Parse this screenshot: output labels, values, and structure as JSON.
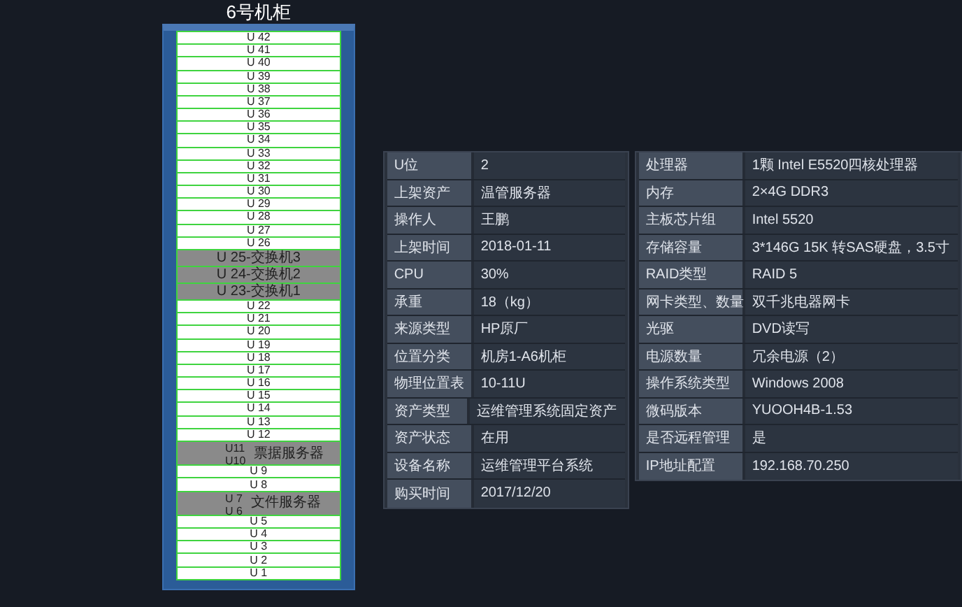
{
  "rack": {
    "title": "6号机柜",
    "slots": [
      {
        "kind": "free",
        "label": "U 42"
      },
      {
        "kind": "free",
        "label": "U 41"
      },
      {
        "kind": "free",
        "label": "U 40"
      },
      {
        "kind": "free",
        "label": "U 39"
      },
      {
        "kind": "free",
        "label": "U 38"
      },
      {
        "kind": "free",
        "label": "U 37"
      },
      {
        "kind": "free",
        "label": "U 36"
      },
      {
        "kind": "free",
        "label": "U 35"
      },
      {
        "kind": "free",
        "label": "U 34"
      },
      {
        "kind": "free",
        "label": "U 33"
      },
      {
        "kind": "free",
        "label": "U 32"
      },
      {
        "kind": "free",
        "label": "U 31"
      },
      {
        "kind": "free",
        "label": "U 30"
      },
      {
        "kind": "free",
        "label": "U 29"
      },
      {
        "kind": "free",
        "label": "U 28"
      },
      {
        "kind": "free",
        "label": "U 27"
      },
      {
        "kind": "free",
        "label": "U 26"
      },
      {
        "kind": "single",
        "label": "U 25-交换机3"
      },
      {
        "kind": "single",
        "label": "U 24-交换机2"
      },
      {
        "kind": "single",
        "label": "U 23-交换机1"
      },
      {
        "kind": "free",
        "label": "U 22"
      },
      {
        "kind": "free",
        "label": "U 21"
      },
      {
        "kind": "free",
        "label": "U 20"
      },
      {
        "kind": "free",
        "label": "U 19"
      },
      {
        "kind": "free",
        "label": "U 18"
      },
      {
        "kind": "free",
        "label": "U 17"
      },
      {
        "kind": "free",
        "label": "U 16"
      },
      {
        "kind": "free",
        "label": "U 15"
      },
      {
        "kind": "free",
        "label": "U 14"
      },
      {
        "kind": "free",
        "label": "U 13"
      },
      {
        "kind": "free",
        "label": "U 12"
      },
      {
        "kind": "multi",
        "units": [
          "U11",
          "U10"
        ],
        "name": "票据服务器"
      },
      {
        "kind": "free",
        "label": "U 9"
      },
      {
        "kind": "free",
        "label": "U 8"
      },
      {
        "kind": "multi",
        "units": [
          "U 7",
          "U 6"
        ],
        "name": "文件服务器"
      },
      {
        "kind": "free",
        "label": "U 5"
      },
      {
        "kind": "free",
        "label": "U 4"
      },
      {
        "kind": "free",
        "label": "U 3"
      },
      {
        "kind": "free",
        "label": "U 2"
      },
      {
        "kind": "free",
        "label": "U 1"
      }
    ]
  },
  "asset_table": {
    "rows": [
      {
        "label": "U位",
        "value": "2"
      },
      {
        "label": "上架资产",
        "value": "温管服务器"
      },
      {
        "label": "操作人",
        "value": "王鹏"
      },
      {
        "label": "上架时间",
        "value": "2018-01-11"
      },
      {
        "label": "CPU",
        "value": "30%"
      },
      {
        "label": "承重",
        "value": "18（kg）"
      },
      {
        "label": "来源类型",
        "value": "HP原厂"
      },
      {
        "label": "位置分类",
        "value": "机房1-A6机柜"
      },
      {
        "label": "物理位置表",
        "value": "10-11U"
      },
      {
        "label": "资产类型",
        "value": "运维管理系统固定资产"
      },
      {
        "label": "资产状态",
        "value": "在用"
      },
      {
        "label": "设备名称",
        "value": "运维管理平台系统"
      },
      {
        "label": "购买时间",
        "value": "2017/12/20"
      }
    ]
  },
  "spec_table": {
    "rows": [
      {
        "label": "处理器",
        "value": "1颗 Intel E5520四核处理器"
      },
      {
        "label": "内存",
        "value": "2×4G DDR3"
      },
      {
        "label": "主板芯片组",
        "value": "Intel 5520"
      },
      {
        "label": "存储容量",
        "value": "3*146G 15K 转SAS硬盘，3.5寸"
      },
      {
        "label": "RAID类型",
        "value": "RAID 5"
      },
      {
        "label": "网卡类型、数量",
        "value": "双千兆电器网卡"
      },
      {
        "label": "光驱",
        "value": "DVD读写"
      },
      {
        "label": "电源数量",
        "value": "冗余电源（2）"
      },
      {
        "label": "操作系统类型",
        "value": "Windows 2008"
      },
      {
        "label": "微码版本",
        "value": "YUOOH4B-1.53"
      },
      {
        "label": "是否远程管理",
        "value": "是"
      },
      {
        "label": "IP地址配置",
        "value": "192.168.70.250"
      }
    ]
  }
}
